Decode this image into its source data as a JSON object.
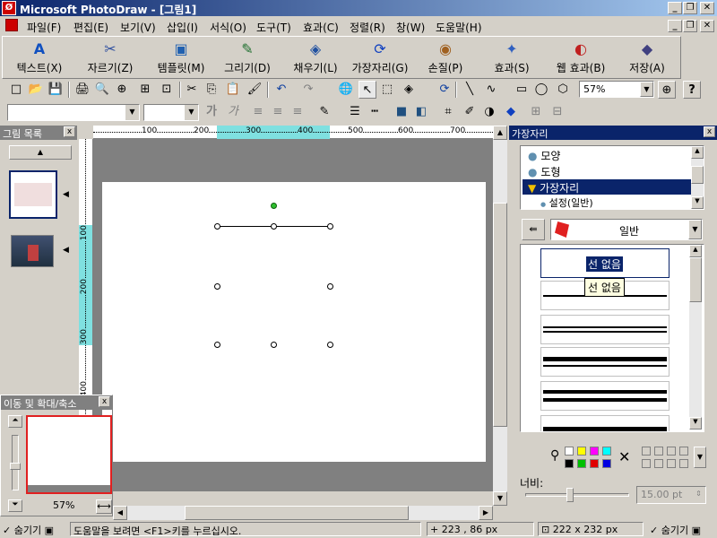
{
  "window": {
    "title": "Microsoft PhotoDraw - [그림1]",
    "minimize": "_",
    "restore": "❐",
    "close": "✕",
    "app_icon": "photodraw-icon"
  },
  "menu": {
    "items": [
      "파일(F)",
      "편집(E)",
      "보기(V)",
      "삽입(I)",
      "서식(O)",
      "도구(T)",
      "효과(C)",
      "정렬(R)",
      "창(W)",
      "도움말(H)"
    ]
  },
  "big_toolbar": {
    "buttons": [
      {
        "label": "텍스트(X)",
        "icon": "A"
      },
      {
        "label": "자르기(Z)",
        "icon": "✂"
      },
      {
        "label": "템플릿(M)",
        "icon": "▣"
      },
      {
        "label": "그리기(D)",
        "icon": "✎"
      },
      {
        "label": "채우기(L)",
        "icon": "◈"
      },
      {
        "label": "가장자리(G)",
        "icon": "⟳"
      },
      {
        "label": "손질(P)",
        "icon": "◉"
      },
      {
        "label": "효과(S)",
        "icon": "✦"
      },
      {
        "label": "웹 효과(B)",
        "icon": "◐"
      },
      {
        "label": "저장(A)",
        "icon": "◆"
      }
    ]
  },
  "std_toolbar": {
    "icons": [
      "□",
      "📂",
      "💾",
      "🖨",
      "🔍",
      "⊕",
      "⊞",
      "⊡",
      "✂",
      "⎘",
      "📋",
      "🖌",
      "↶",
      "↷",
      "🌐",
      "↖",
      "⬚",
      "◈",
      "⟳",
      "╲",
      "∿",
      "▭",
      "◯",
      "⬡"
    ],
    "zoom": "57%",
    "help": "?"
  },
  "format_toolbar": {
    "bold": "가",
    "italic": "가"
  },
  "left_panel": {
    "title": "그림 목록",
    "close": "x"
  },
  "ruler": {
    "h_ticks": [
      "100",
      "200",
      "300",
      "400",
      "500",
      "600",
      "700"
    ],
    "v_ticks": [
      "100",
      "200",
      "300",
      "400"
    ]
  },
  "right_panel": {
    "title": "가장자리",
    "close": "x",
    "list": [
      "모양",
      "도형",
      "가장자리",
      "설정(일반)"
    ],
    "style_select": "일반",
    "line_options": [
      "선 없음",
      "",
      "",
      "",
      "",
      ""
    ],
    "tooltip": "선 없음",
    "width_label": "너비:",
    "width_value": "15.00 pt"
  },
  "nav_panel": {
    "title": "이동 및 확대/축소",
    "close": "x",
    "zoom": "57%"
  },
  "status": {
    "hide_left": "숨기기",
    "help_text": "도움말을 보려면 <F1>키를 누르십시오.",
    "position": "223 , 86  px",
    "size": "222 x 232  px",
    "hide_right": "숨기기"
  },
  "colors": {
    "title_bar_start": "#0a246a",
    "title_bar_end": "#a6caf0",
    "ruler_highlight": "#7fe0e0",
    "selection_highlight": "#0a246a",
    "rotation_handle": "#2fbf2f"
  }
}
